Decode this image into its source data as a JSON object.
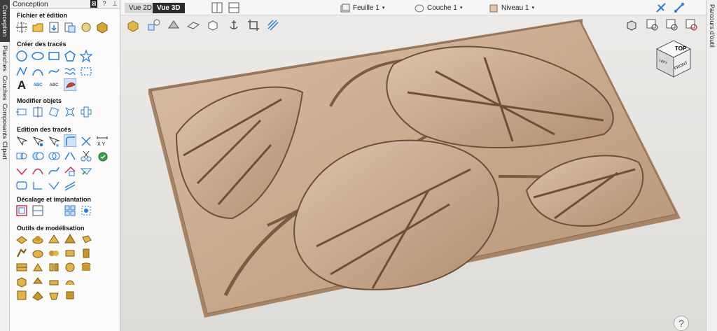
{
  "left_tabs": [
    "Conception",
    "Planches",
    "Couches",
    "Composants",
    "Clipart"
  ],
  "right_tabs": [
    "Parcours d'outil"
  ],
  "panel": {
    "title": "Conception",
    "header_buttons": [
      "⊠",
      "?",
      "⊥"
    ],
    "sections": [
      "Fichier et édition",
      "Créer des tracés",
      "Modifier objets",
      "Edition des tracés",
      "Décalage et implantation",
      "Outils de modélisation"
    ],
    "text_tool_labels": [
      "A",
      "ABC",
      "ABC"
    ]
  },
  "topbar": {
    "view_2d": "Vue 2D",
    "view_3d": "Vue 3D",
    "sheet": "Feuille 1",
    "layer": "Couche 1",
    "level": "Niveau 1",
    "caret": "▾"
  },
  "cube": {
    "top": "TOP",
    "front": "FRONT",
    "left": "LEFT"
  },
  "help": "?",
  "colors": {
    "accent": "#2b2b2b",
    "relief": "#c9a98c",
    "selection": "#cfe2f7"
  }
}
